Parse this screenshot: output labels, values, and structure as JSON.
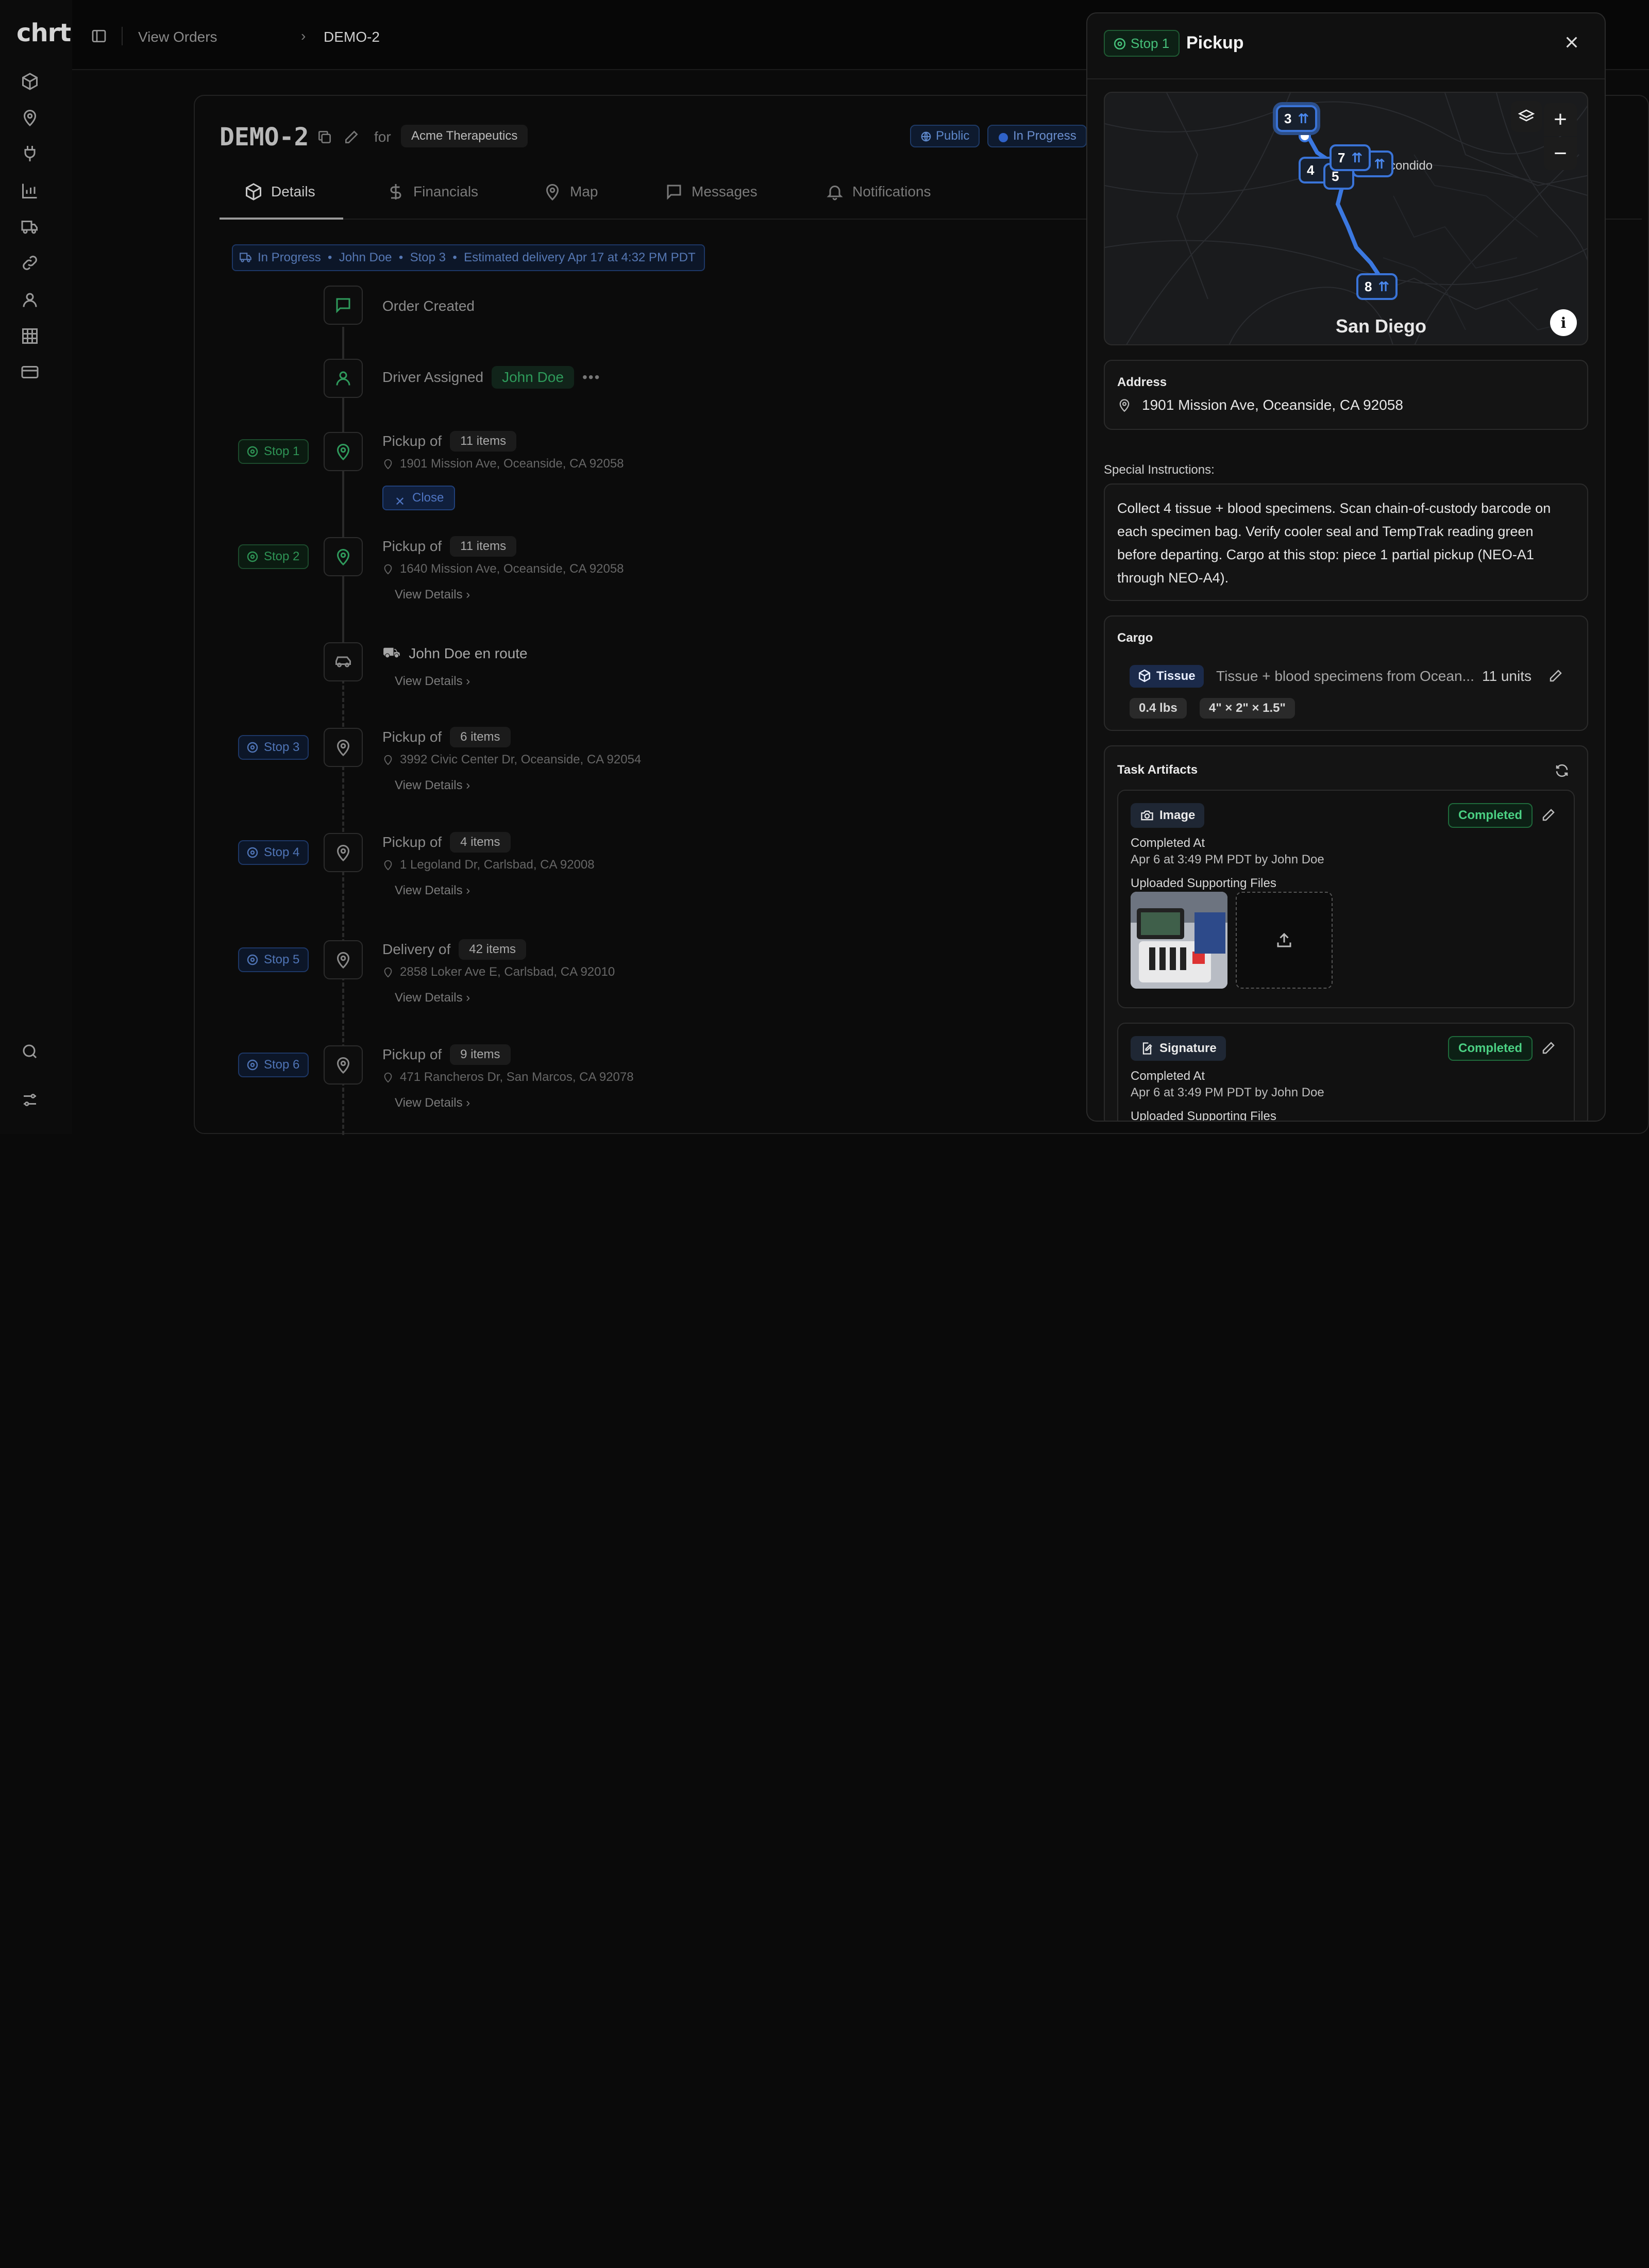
{
  "app": {
    "logo": "chrt"
  },
  "breadcrumb": {
    "parent": "View Orders",
    "current": "DEMO-2"
  },
  "order": {
    "id": "DEMO-2",
    "for_label": "for",
    "company": "Acme Therapeutics",
    "visibility": "Public",
    "status": "In Progress"
  },
  "tabs": [
    {
      "label": "Details",
      "icon": "box-icon",
      "active": true
    },
    {
      "label": "Financials",
      "icon": "dollar-icon"
    },
    {
      "label": "Map",
      "icon": "pin-icon"
    },
    {
      "label": "Messages",
      "icon": "message-icon"
    },
    {
      "label": "Notifications",
      "icon": "bell-icon"
    }
  ],
  "status_bar": {
    "text": "In Progress  •  John Doe  •  Stop 3  •  Estimated delivery Apr 17 at 4:32 PM PDT"
  },
  "timeline": {
    "order_created": "Order Created",
    "driver_assigned": "Driver Assigned",
    "driver_name": "John Doe",
    "close_label": "Close",
    "view_details": "View Details",
    "en_route": "John Doe en route",
    "stops": [
      {
        "badge": "Stop 1",
        "action": "Pickup of",
        "items": "11 items",
        "address": "1901 Mission Ave, Oceanside, CA 92058"
      },
      {
        "badge": "Stop 2",
        "action": "Pickup of",
        "items": "11 items",
        "address": "1640 Mission Ave, Oceanside, CA 92058"
      },
      {
        "badge": "Stop 3",
        "action": "Pickup of",
        "items": "6 items",
        "address": "3992 Civic Center Dr, Oceanside, CA 92054"
      },
      {
        "badge": "Stop 4",
        "action": "Pickup of",
        "items": "4 items",
        "address": "1 Legoland Dr, Carlsbad, CA 92008"
      },
      {
        "badge": "Stop 5",
        "action": "Delivery of",
        "items": "42 items",
        "address": "2858 Loker Ave E, Carlsbad, CA 92010"
      },
      {
        "badge": "Stop 6",
        "action": "Pickup of",
        "items": "9 items",
        "address": "471 Rancheros Dr, San Marcos, CA 92078"
      }
    ]
  },
  "panel": {
    "stop_badge": "Stop 1",
    "title": "Pickup",
    "map": {
      "city": "San Diego",
      "city2": "scondido",
      "markers": [
        "3",
        "4",
        "5",
        "6",
        "7",
        "8"
      ]
    },
    "address_label": "Address",
    "address": "1901 Mission Ave, Oceanside, CA 92058",
    "special_label": "Special Instructions:",
    "special_text": "Collect 4 tissue + blood specimens. Scan chain-of-custody barcode on each specimen bag. Verify cooler seal and TempTrak reading green before departing. Cargo at this stop: piece 1 partial pickup (NEO-A1 through NEO-A4).",
    "cargo_label": "Cargo",
    "cargo": {
      "type": "Tissue",
      "description": "Tissue + blood specimens from Ocean...",
      "units": "11 units",
      "weight": "0.4 lbs",
      "dims": "4\" × 2\" × 1.5\""
    },
    "artifacts_label": "Task Artifacts",
    "artifacts": [
      {
        "type": "Image",
        "status": "Completed",
        "completed_at_label": "Completed At",
        "completed_at": "Apr 6 at 3:49 PM PDT by John Doe",
        "files_label": "Uploaded Supporting Files"
      },
      {
        "type": "Signature",
        "status": "Completed",
        "completed_at_label": "Completed At",
        "completed_at": "Apr 6 at 3:49 PM PDT by John Doe",
        "files_label": "Uploaded Supporting Files"
      }
    ]
  }
}
